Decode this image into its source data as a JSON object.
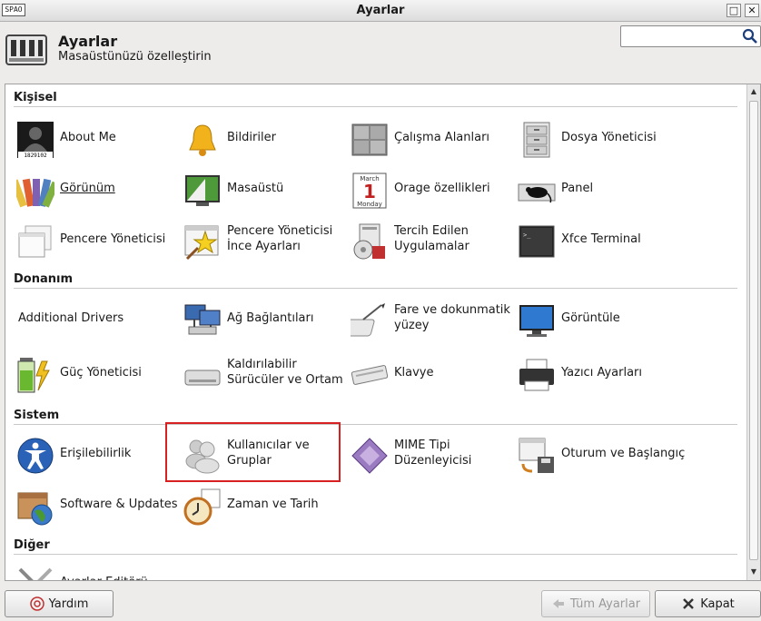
{
  "window": {
    "title": "Ayarlar",
    "app_icon_text": "SPAO"
  },
  "header": {
    "title": "Ayarlar",
    "subtitle": "Masaüstünüzü özelleştirin"
  },
  "search": {
    "placeholder": ""
  },
  "sections": {
    "kisisel": "Kişisel",
    "donanim": "Donanım",
    "sistem": "Sistem",
    "diger": "Diğer"
  },
  "items": {
    "about_me": "About Me",
    "about_me_badge": "1829102",
    "bildiriler": "Bildiriler",
    "calisma_alanlari": "Çalışma Alanları",
    "dosya_yoneticisi": "Dosya Yöneticisi",
    "gorunum": "Görünüm",
    "masaustu": "Masaüstü",
    "orage": "Orage özellikleri",
    "orage_month": "March",
    "orage_day": "1",
    "orage_weekday": "Monday",
    "panel": "Panel",
    "pencere_yoneticisi": "Pencere Yöneticisi",
    "pencere_ince": "Pencere Yöneticisi İnce Ayarları",
    "tercih_edilen": "Tercih Edilen Uygulamalar",
    "xfce_terminal": "Xfce Terminal",
    "additional_drivers": "Additional Drivers",
    "ag_baglantilari": "Ağ Bağlantıları",
    "fare": "Fare ve dokunmatik yüzey",
    "goruntule": "Görüntüle",
    "guc": "Güç Yöneticisi",
    "kaldirilabilir": "Kaldırılabilir Sürücüler ve Ortam",
    "klavye": "Klavye",
    "yazici": "Yazıcı Ayarları",
    "erisilebilirlik": "Erişilebilirlik",
    "kullanicilar": "Kullanıcılar ve Gruplar",
    "mime": "MIME Tipi Düzenleyicisi",
    "oturum": "Oturum ve Başlangıç",
    "software": "Software & Updates",
    "zaman": "Zaman ve Tarih",
    "ayarlar_editoru": "Ayarlar Editörü"
  },
  "footer": {
    "help": "Yardım",
    "all_settings": "Tüm Ayarlar",
    "close": "Kapat"
  },
  "icons": {
    "window_maximize": "maximize-icon",
    "window_close": "close-icon",
    "search": "search-icon"
  },
  "colors": {
    "highlight": "#d92020"
  }
}
